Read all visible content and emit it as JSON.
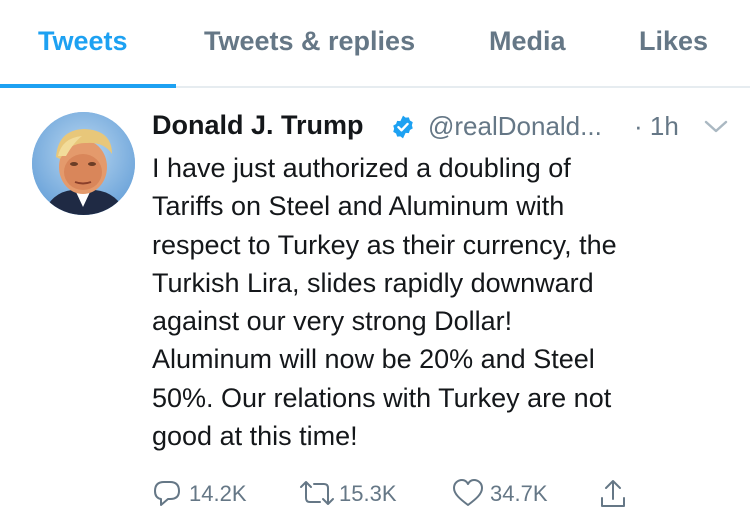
{
  "tabs": [
    {
      "label": "Tweets",
      "active": true
    },
    {
      "label": "Tweets & replies",
      "active": false
    },
    {
      "label": "Media",
      "active": false
    },
    {
      "label": "Likes",
      "active": false
    }
  ],
  "colors": {
    "accent": "#1da1f2",
    "secondary_text": "#657786",
    "primary_text": "#14171a",
    "divider": "#e6ecf0"
  },
  "tweet": {
    "author_name": "Donald J. Trump",
    "verified": true,
    "handle": "@realDonald...",
    "time": "· 1h",
    "text_lines": [
      "I have just authorized a doubling of",
      "Tariffs on Steel and Aluminum with",
      "respect to Turkey as their currency, the",
      "Turkish Lira, slides rapidly downward",
      "against our very strong Dollar!",
      "Aluminum will now be 20% and Steel",
      "50%. Our relations with Turkey are not",
      "good at this time!"
    ],
    "actions": {
      "replies": "14.2K",
      "retweets": "15.3K",
      "likes": "34.7K"
    }
  },
  "icons": [
    "verified-badge-icon",
    "chevron-down-icon",
    "reply-icon",
    "retweet-icon",
    "like-icon",
    "share-icon"
  ]
}
